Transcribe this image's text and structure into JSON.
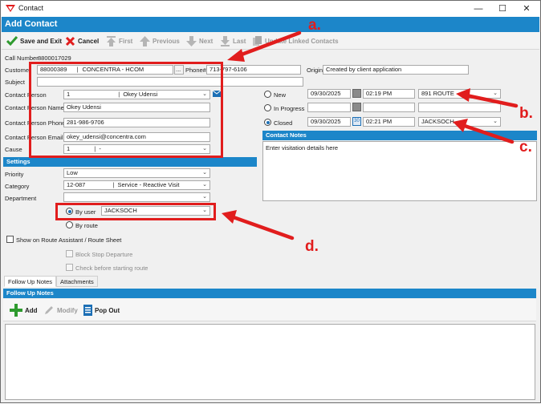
{
  "window": {
    "title": "Contact"
  },
  "header": {
    "title": "Add Contact"
  },
  "toolbar": {
    "save_exit": "Save and Exit",
    "cancel": "Cancel",
    "first": "First",
    "previous": "Previous",
    "next": "Next",
    "last": "Last",
    "update_linked": "Update Linked Contacts"
  },
  "form": {
    "call_number_label": "Call Number",
    "call_number": "8800017029",
    "customer_label": "Customer",
    "customer_id": "88000389",
    "customer_name": "CONCENTRA - HCOM",
    "ellipsis": "...",
    "phone_label": "Phone#",
    "phone": "713-797-6106",
    "origin_label": "Origin",
    "origin": "Created by client application",
    "subject_label": "Subject",
    "subject": "",
    "contact_person_label": "Contact Person",
    "contact_person_id": "1",
    "contact_person_name": "Okey Udensi",
    "contact_person_name_label": "Contact Person Name",
    "contact_person_name_value": "Okey Udensi",
    "contact_person_phone_label": "Contact Person Phone",
    "contact_person_phone": "281-986-9706",
    "contact_person_email_label": "Contact Person Email",
    "contact_person_email": "okey_udensi@concentra.com",
    "cause_label": "Cause",
    "cause_id": "1",
    "cause_name": "-",
    "separator": "|"
  },
  "status": {
    "new_label": "New",
    "new_date": "09/30/2025",
    "new_time": "02:19 PM",
    "new_route": "891 ROUTE",
    "in_progress_label": "In Progress",
    "closed_label": "Closed",
    "closed_date": "09/30/2025",
    "closed_time": "02:21 PM",
    "closed_user": "JACKSOCH",
    "calendar_day": "30"
  },
  "contact_notes": {
    "title": "Contact Notes",
    "text": "Enter visitation details here"
  },
  "settings": {
    "title": "Settings",
    "priority_label": "Priority",
    "priority": "Low",
    "category_label": "Category",
    "category_id": "12-087",
    "category_name": "Service - Reactive Visit",
    "department_label": "Department",
    "department": "",
    "by_user_label": "By user",
    "by_user_value": "JACKSOCH",
    "by_route_label": "By route",
    "show_route_label": "Show on Route Assistant / Route Sheet",
    "block_stop_label": "Block Stop Departure",
    "check_before_label": "Check before starting route"
  },
  "tabs": [
    "Follow Up Notes",
    "Attachments"
  ],
  "follow_up": {
    "title": "Follow Up Notes",
    "add": "Add",
    "modify": "Modify",
    "pop_out": "Pop Out"
  },
  "annotations": [
    "a.",
    "b.",
    "c.",
    "d."
  ],
  "colors": {
    "accent": "#1c86c9",
    "annotation": "#e11d1d"
  }
}
